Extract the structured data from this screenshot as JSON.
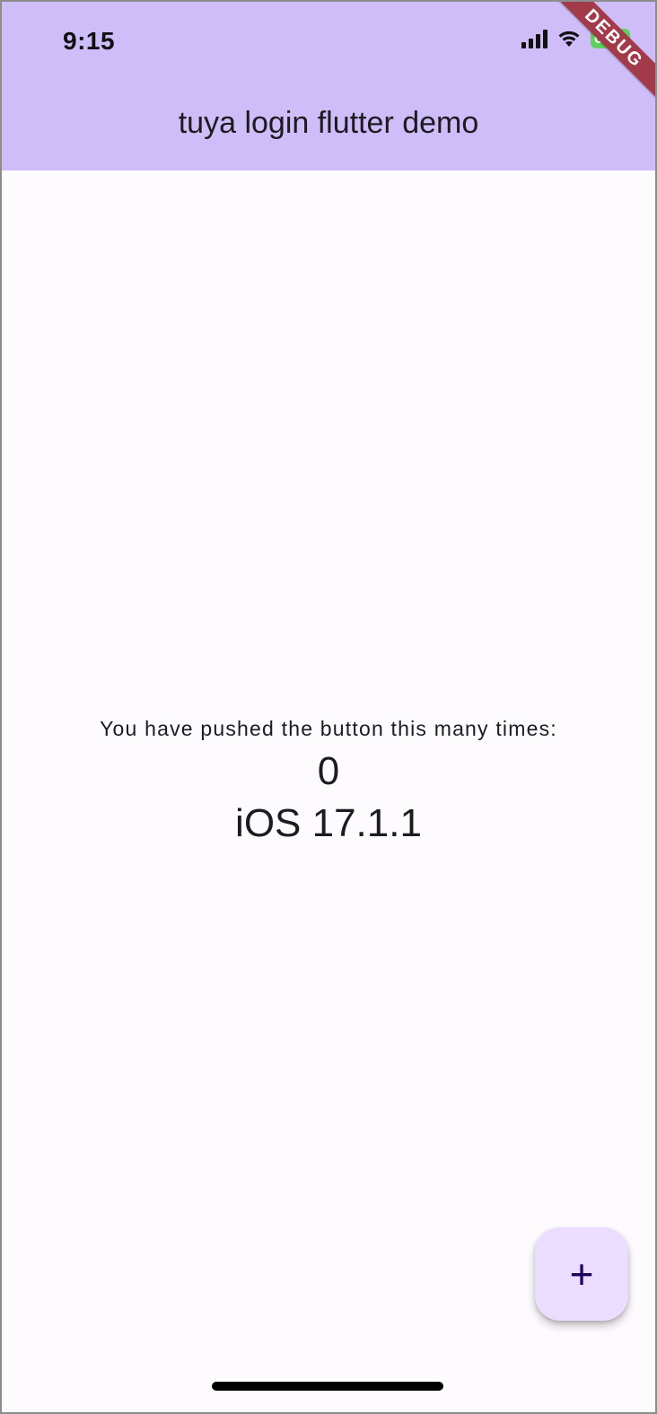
{
  "status_bar": {
    "time": "9:15",
    "battery": "68",
    "icons": [
      "signal-icon",
      "wifi-icon",
      "battery-charging-icon"
    ]
  },
  "app_bar": {
    "title": "tuya login flutter demo",
    "color": "#cebdf9"
  },
  "debug_banner": "DEBUG",
  "body": {
    "counter_label": "You have pushed the button this many times:",
    "counter_value": "0",
    "os_version": "iOS 17.1.1"
  },
  "fab": {
    "label": "+",
    "icon": "add-icon",
    "color": "#eaddff"
  }
}
